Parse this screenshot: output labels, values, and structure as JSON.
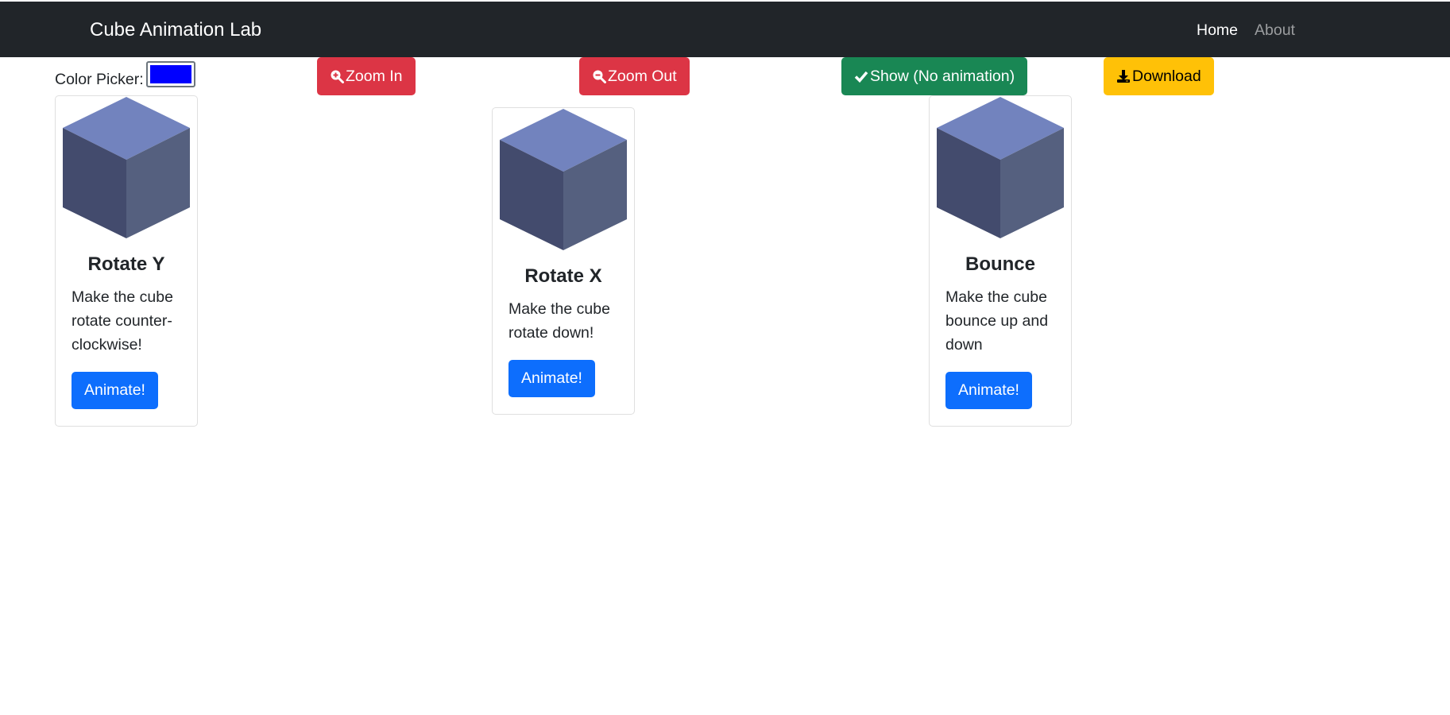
{
  "navbar": {
    "brand": "Cube Animation Lab",
    "links": [
      {
        "label": "Home",
        "active": true
      },
      {
        "label": "About",
        "active": false
      }
    ]
  },
  "color_picker": {
    "label": "Color Picker:",
    "value": "#0000ff"
  },
  "toolbar": {
    "zoom_in": {
      "label": "Zoom In",
      "icon": "zoom-in-icon"
    },
    "zoom_out": {
      "label": "Zoom Out",
      "icon": "zoom-out-icon"
    },
    "show": {
      "label": "Show (No animation)",
      "icon": "check-icon"
    },
    "download": {
      "label": "Download",
      "icon": "download-icon"
    }
  },
  "cards": [
    {
      "title": "Rotate Y",
      "text": "Make the cube rotate counter-clockwise!",
      "button": "Animate!"
    },
    {
      "title": "Rotate X",
      "text": "Make the cube rotate down!",
      "button": "Animate!"
    },
    {
      "title": "Bounce",
      "text": "Make the cube bounce up and down",
      "button": "Animate!"
    }
  ],
  "colors": {
    "navbar_bg": "#212529",
    "danger": "#dc3545",
    "success": "#198754",
    "warning": "#ffc107",
    "primary": "#0d6efd",
    "cube_top": "#7283be",
    "cube_left": "#434b6d",
    "cube_right": "#55607f"
  }
}
